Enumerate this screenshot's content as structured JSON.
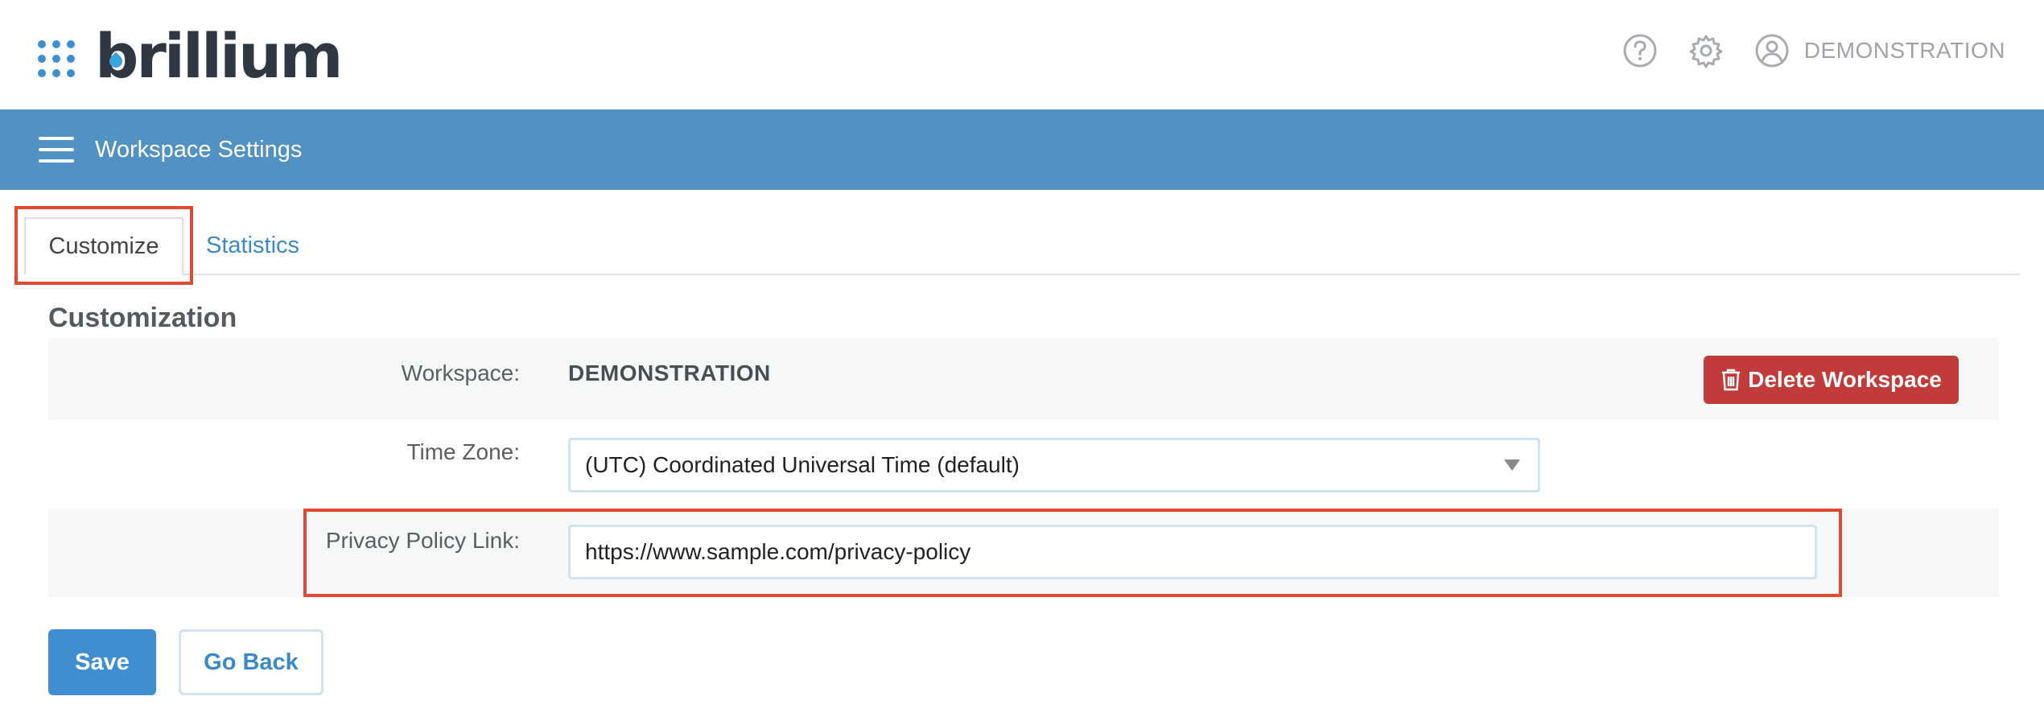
{
  "app": {
    "logo_text": "brillium",
    "user_name": "DEMONSTRATION",
    "icons": [
      "grid-menu-icon",
      "help-icon",
      "gear-icon",
      "user-avatar-icon",
      "hamburger-icon",
      "trash-icon",
      "chevron-down-icon"
    ],
    "colors": {
      "accent": "#5191c4",
      "primary_button": "#3f8ed0",
      "danger": "#c23b3b",
      "highlight": "#e04a32",
      "link": "#3b8ac4"
    }
  },
  "header": {
    "title": "Workspace Settings"
  },
  "tabs": [
    {
      "label": "Customize",
      "active": true
    },
    {
      "label": "Statistics",
      "active": false
    }
  ],
  "section": {
    "title": "Customization"
  },
  "form": {
    "workspace_label": "Workspace:",
    "workspace_value": "DEMONSTRATION",
    "delete_label": "Delete Workspace",
    "timezone_label": "Time Zone:",
    "timezone_value": "(UTC) Coordinated Universal Time (default)",
    "privacy_label": "Privacy Policy Link:",
    "privacy_value": "https://www.sample.com/privacy-policy"
  },
  "actions": {
    "save_label": "Save",
    "back_label": "Go Back"
  }
}
